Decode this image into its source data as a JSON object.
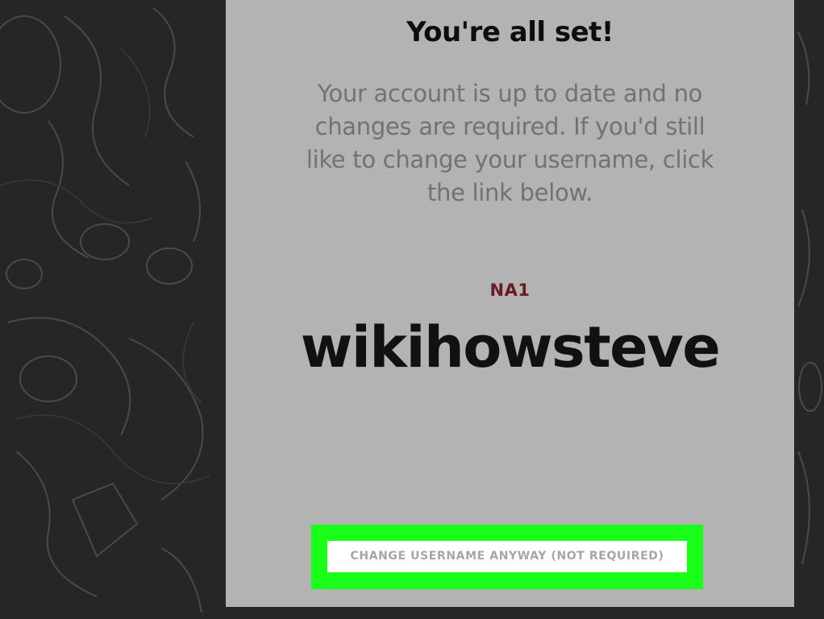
{
  "dialog": {
    "title": "You're all set!",
    "message": "Your account is up to date and no changes are required. If you'd still like to change your username, click the link below.",
    "region": "NA1",
    "username": "wikihowsteve",
    "change_link_label": "CHANGE USERNAME ANYWAY (NOT REQUIRED)"
  },
  "colors": {
    "page_background": "#262626",
    "card_background": "#b3b3b3",
    "region_text": "#6b1a22",
    "highlight": "#1aff1a"
  }
}
